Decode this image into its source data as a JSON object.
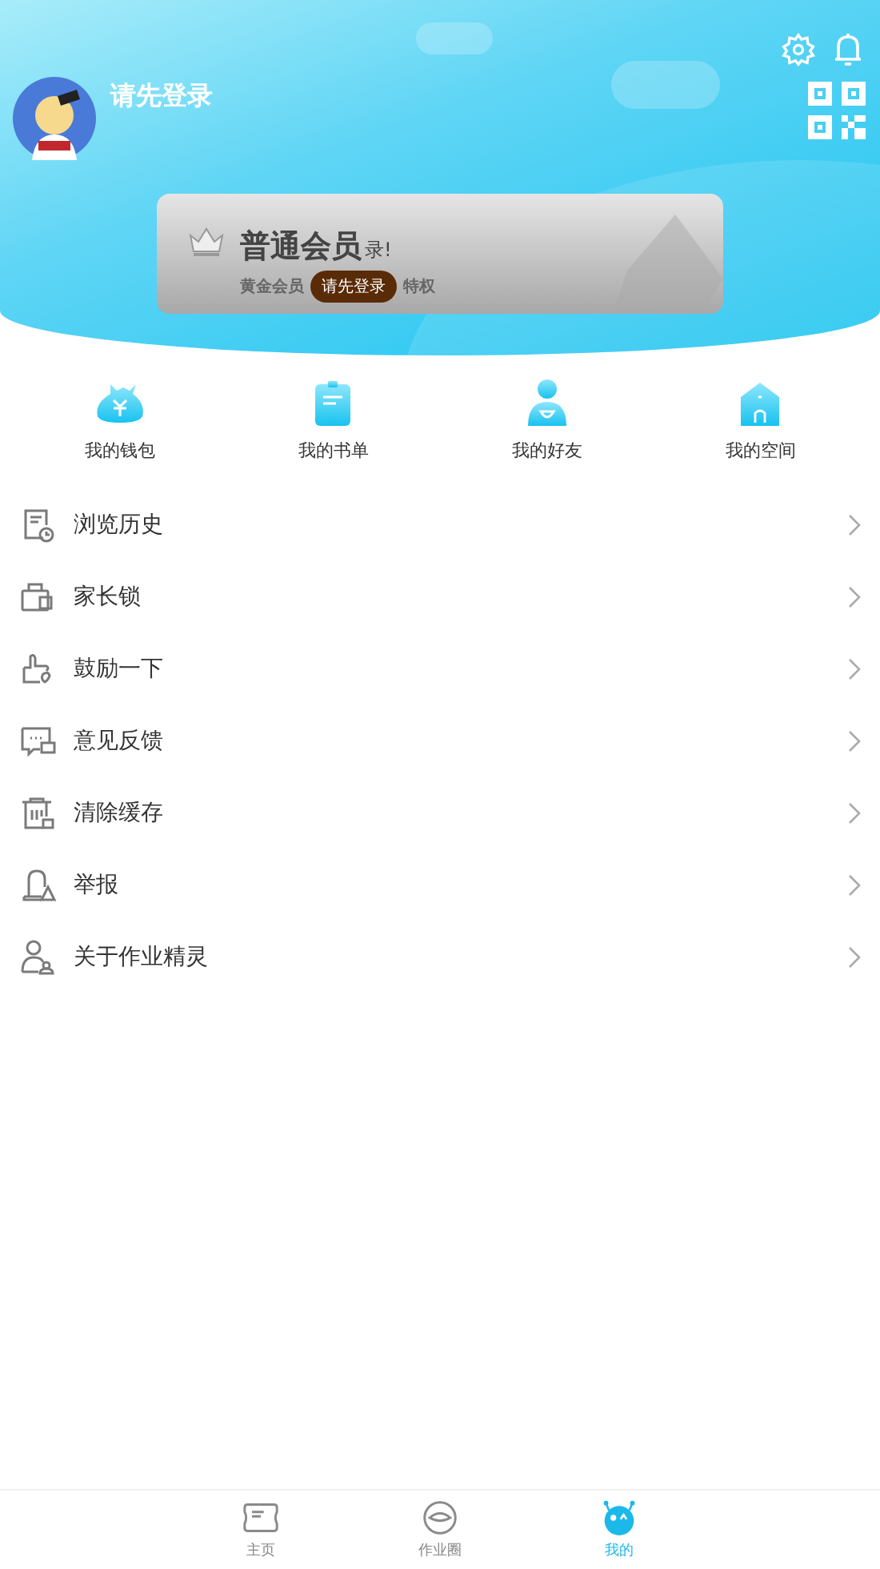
{
  "header": {
    "login_prompt": "请先登录"
  },
  "member_card": {
    "title": "普通会员",
    "notice": "录!",
    "subtitle_start": "黄金会员",
    "subtitle_end": "特权",
    "badge": "请先登录"
  },
  "shortcuts": [
    {
      "label": "我的钱包"
    },
    {
      "label": "我的书单"
    },
    {
      "label": "我的好友"
    },
    {
      "label": "我的空间"
    }
  ],
  "menu": [
    {
      "label": "浏览历史"
    },
    {
      "label": "家长锁"
    },
    {
      "label": "鼓励一下"
    },
    {
      "label": "意见反馈"
    },
    {
      "label": "清除缓存"
    },
    {
      "label": "举报"
    },
    {
      "label": "关于作业精灵"
    }
  ],
  "tab_bar": [
    {
      "label": "主页",
      "selected": false
    },
    {
      "label": "作业圈",
      "selected": false
    },
    {
      "label": "我的",
      "selected": true
    }
  ]
}
